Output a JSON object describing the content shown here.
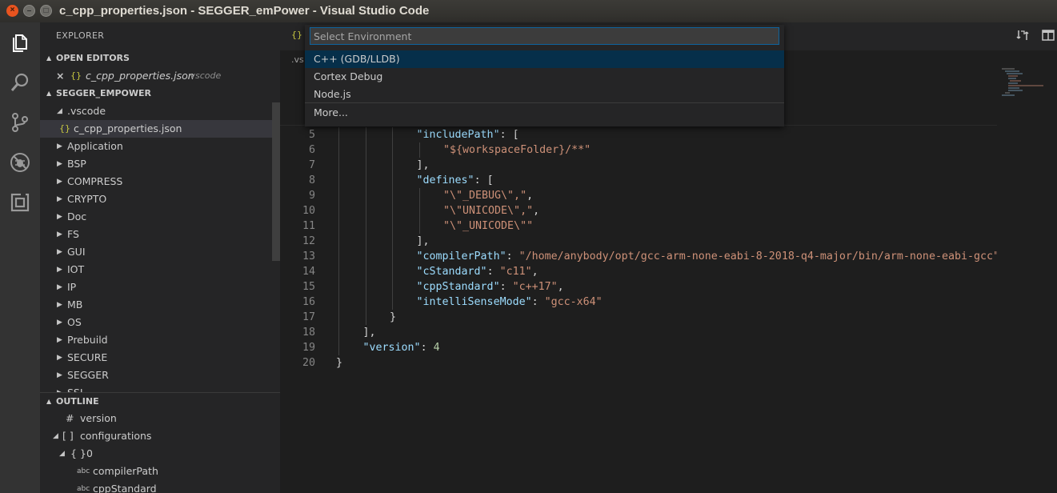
{
  "window": {
    "title": "c_cpp_properties.json - SEGGER_emPower - Visual Studio Code"
  },
  "activity_bar": {
    "items": [
      {
        "name": "explorer",
        "icon": "files-icon"
      },
      {
        "name": "search",
        "icon": "search-icon"
      },
      {
        "name": "source-control",
        "icon": "source-control-icon"
      },
      {
        "name": "debug",
        "icon": "debug-icon"
      },
      {
        "name": "extensions",
        "icon": "extensions-icon"
      }
    ]
  },
  "sidebar": {
    "title": "EXPLORER",
    "open_editors": {
      "header": "OPEN EDITORS",
      "items": [
        {
          "close": "×",
          "icon": "{}",
          "name": "c_cpp_properties.json",
          "folder": ".vscode"
        }
      ]
    },
    "workspace": {
      "header": "SEGGER_EMPOWER",
      "expanded_folder": ".vscode",
      "selected_file": {
        "icon": "{}",
        "name": "c_cpp_properties.json"
      },
      "folders": [
        "Application",
        "BSP",
        "COMPRESS",
        "CRYPTO",
        "Doc",
        "FS",
        "GUI",
        "IOT",
        "IP",
        "MB",
        "OS",
        "Prebuild",
        "SECURE",
        "SEGGER",
        "SSL"
      ]
    },
    "outline": {
      "header": "OUTLINE",
      "items": [
        {
          "symbol": "#",
          "label": "version"
        },
        {
          "symbol": "[ ]",
          "label": "configurations"
        },
        {
          "symbol": "{ }",
          "label": "0"
        },
        {
          "symbol": "abc",
          "label": "compilerPath"
        },
        {
          "symbol": "abc",
          "label": "cppStandard"
        }
      ]
    }
  },
  "editor": {
    "tab_icon": "{}",
    "breadcrumb": ".vs",
    "lines": [
      {
        "n": "5",
        "indent": 3,
        "key": "\"includePath\"",
        "rest": ": ["
      },
      {
        "n": "6",
        "indent": 4,
        "str": "\"${workspaceFolder}/**\""
      },
      {
        "n": "7",
        "indent": 3,
        "plain": "],"
      },
      {
        "n": "8",
        "indent": 3,
        "key": "\"defines\"",
        "rest": ": ["
      },
      {
        "n": "9",
        "indent": 4,
        "str": "\"\\\"_DEBUG\\\",\"",
        "rest": ","
      },
      {
        "n": "10",
        "indent": 4,
        "str": "\"\\\"UNICODE\\\",\"",
        "rest": ","
      },
      {
        "n": "11",
        "indent": 4,
        "str": "\"\\\"_UNICODE\\\"\""
      },
      {
        "n": "12",
        "indent": 3,
        "plain": "],"
      },
      {
        "n": "13",
        "indent": 3,
        "key": "\"compilerPath\"",
        "rest": ": ",
        "val": "\"/home/anybody/opt/gcc-arm-none-eabi-8-2018-q4-major/bin/arm-none-eabi-gcc\""
      },
      {
        "n": "14",
        "indent": 3,
        "key": "\"cStandard\"",
        "rest": ": ",
        "val": "\"c11\"",
        "tail": ","
      },
      {
        "n": "15",
        "indent": 3,
        "key": "\"cppStandard\"",
        "rest": ": ",
        "val": "\"c++17\"",
        "tail": ","
      },
      {
        "n": "16",
        "indent": 3,
        "key": "\"intelliSenseMode\"",
        "rest": ": ",
        "val": "\"gcc-x64\""
      },
      {
        "n": "17",
        "indent": 2,
        "plain": "}"
      },
      {
        "n": "18",
        "indent": 1,
        "plain": "],"
      },
      {
        "n": "19",
        "indent": 1,
        "key": "\"version\"",
        "rest": ": ",
        "num": "4"
      },
      {
        "n": "20",
        "indent": 0,
        "plain": "}"
      }
    ]
  },
  "quick_pick": {
    "placeholder": "Select Environment",
    "value": "",
    "items": [
      {
        "label": "C++ (GDB/LLDB)",
        "active": true
      },
      {
        "label": "Cortex Debug",
        "active": false
      },
      {
        "label": "Node.js",
        "active": false
      },
      {
        "label": "More...",
        "active": false
      }
    ]
  },
  "colors": {
    "activity_bar": "#333333",
    "sidebar": "#252526",
    "editor": "#1e1e1e",
    "json_key": "#9cdcfe",
    "json_string": "#ce9178",
    "json_number": "#b5cea8",
    "focus_border": "#0e639c",
    "quick_pick_active": "#062f4a"
  }
}
